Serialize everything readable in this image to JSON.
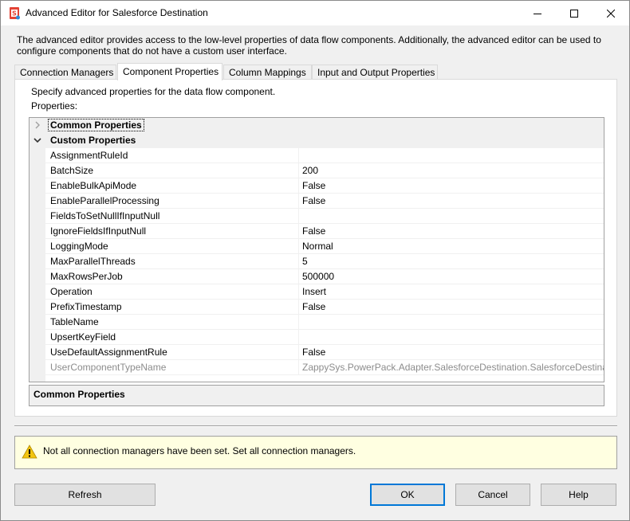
{
  "window": {
    "title": "Advanced Editor for Salesforce Destination"
  },
  "description": "The advanced editor provides access to the low-level properties of data flow components. Additionally, the advanced editor can be used to configure components that do not have a custom user interface.",
  "tabs": [
    {
      "label": "Connection Managers",
      "active": false
    },
    {
      "label": "Component Properties",
      "active": true
    },
    {
      "label": "Column Mappings",
      "active": false
    },
    {
      "label": "Input and Output Properties",
      "active": false
    }
  ],
  "panel": {
    "hint": "Specify advanced properties for the data flow component.",
    "properties_label": "Properties:"
  },
  "grid": {
    "categories": {
      "common": "Common Properties",
      "custom": "Custom Properties"
    },
    "properties": [
      {
        "name": "AssignmentRuleId",
        "value": ""
      },
      {
        "name": "BatchSize",
        "value": "200"
      },
      {
        "name": "EnableBulkApiMode",
        "value": "False"
      },
      {
        "name": "EnableParallelProcessing",
        "value": "False"
      },
      {
        "name": "FieldsToSetNullIfInputNull",
        "value": ""
      },
      {
        "name": "IgnoreFieldsIfInputNull",
        "value": "False"
      },
      {
        "name": "LoggingMode",
        "value": "Normal"
      },
      {
        "name": "MaxParallelThreads",
        "value": "5"
      },
      {
        "name": "MaxRowsPerJob",
        "value": "500000"
      },
      {
        "name": "Operation",
        "value": "Insert"
      },
      {
        "name": "PrefixTimestamp",
        "value": "False"
      },
      {
        "name": "TableName",
        "value": ""
      },
      {
        "name": "UpsertKeyField",
        "value": ""
      },
      {
        "name": "UseDefaultAssignmentRule",
        "value": "False"
      },
      {
        "name": "UserComponentTypeName",
        "value": "ZappySys.PowerPack.Adapter.SalesforceDestination.SalesforceDestination"
      }
    ]
  },
  "description_box": {
    "title": "Common Properties"
  },
  "warning": {
    "text": "Not all connection managers have been set. Set all connection managers."
  },
  "buttons": {
    "refresh": "Refresh",
    "ok": "OK",
    "cancel": "Cancel",
    "help": "Help"
  },
  "colors": {
    "accent": "#0078d7",
    "warning_bg": "#ffffe1",
    "readonly_text": "#8c8c8c"
  }
}
